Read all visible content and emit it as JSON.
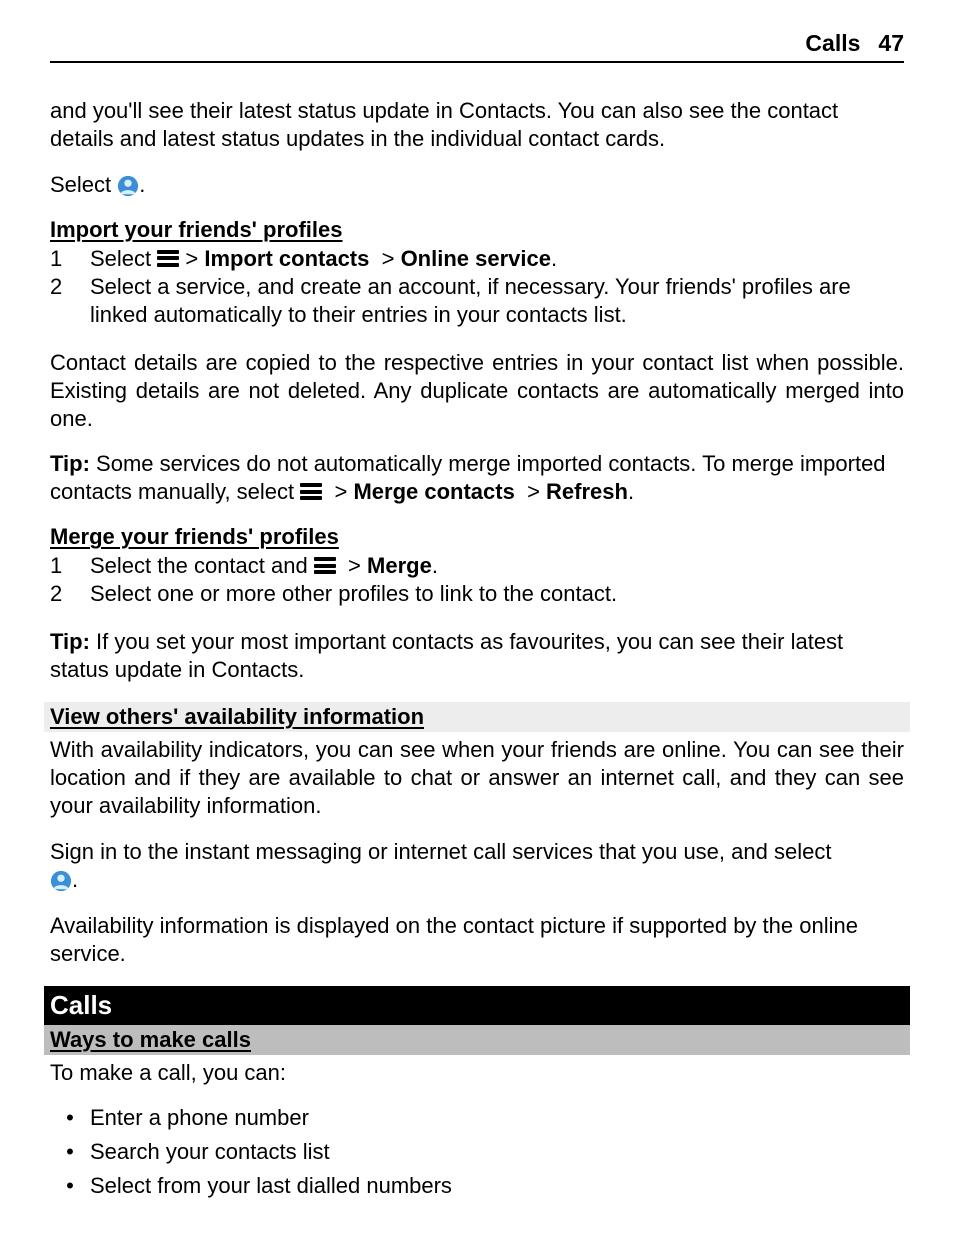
{
  "header": {
    "section": "Calls",
    "page": "47"
  },
  "intro": "and you'll see their latest status update in Contacts. You can also see the contact details and latest status updates in the individual contact cards.",
  "selectPrefix": "Select ",
  "import": {
    "heading": "Import your friends' profiles",
    "step1_a": "Select ",
    "step1_b": "Import contacts",
    "step1_c": "Online service",
    "step2": "Select a service, and create an account, if necessary. Your friends' profiles are linked automatically to their entries in your contacts list.",
    "note": "Contact details are copied to the respective entries in your contact list when possible. Existing details are not deleted. Any duplicate contacts are automatically merged into one."
  },
  "tip1": {
    "label": "Tip:",
    "a": " Some services do not automatically merge imported contacts. To merge imported contacts manually, select ",
    "b": "Merge contacts",
    "c": "Refresh"
  },
  "merge": {
    "heading": "Merge your friends' profiles",
    "step1_a": "Select the contact and ",
    "step1_b": "Merge",
    "step2": "Select one or more other profiles to link to the contact."
  },
  "tip2": {
    "label": "Tip:",
    "text": " If you set your most important contacts as favourites, you can see their latest status update in Contacts."
  },
  "availability": {
    "heading": "View others' availability information",
    "p1": "With availability indicators, you can see when your friends are online. You can see their location and if they are available to chat or answer an internet call, and they can see your availability information.",
    "p2": "Sign in to the instant messaging or internet call services that you use, and select ",
    "p3": "Availability information is displayed on the contact picture if supported by the online service."
  },
  "calls": {
    "chapter": "Calls",
    "sub": "Ways to make calls",
    "intro": "To make a call, you can:",
    "bullets": [
      "Enter a phone number",
      "Search your contacts list",
      "Select from your last dialled numbers"
    ]
  }
}
